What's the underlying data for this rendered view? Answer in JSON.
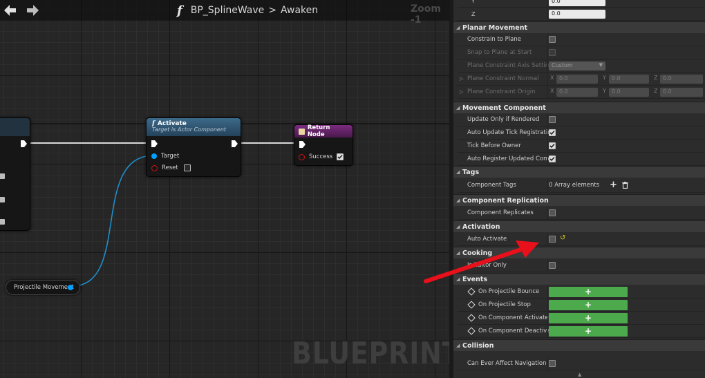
{
  "graph": {
    "breadcrumb": {
      "function_glyph": "f",
      "blueprint": "BP_SplineWave",
      "separator": ">",
      "event": "Awaken"
    },
    "zoom_label": "Zoom -1",
    "watermark": "BLUEPRINT",
    "nodes": {
      "activate": {
        "title": "Activate",
        "subtitle": "Target is Actor Component",
        "pin_target": "Target",
        "pin_reset": "Reset"
      },
      "return": {
        "title": "Return Node",
        "pin_success": "Success"
      },
      "variable": {
        "label": "Projectile Movement"
      }
    }
  },
  "panel": {
    "vector_rows": [
      {
        "axis": "Y",
        "value": "0.0"
      },
      {
        "axis": "Z",
        "value": "0.0"
      }
    ],
    "categories": {
      "planar": "Planar Movement",
      "movement_component": "Movement Component",
      "tags": "Tags",
      "replication": "Component Replication",
      "activation": "Activation",
      "cooking": "Cooking",
      "events": "Events",
      "collision": "Collision"
    },
    "planar": {
      "constrain_to_plane": "Constrain to Plane",
      "snap_to_plane": "Snap to Plane at Start",
      "axis_setting_label": "Plane Constraint Axis Setting",
      "axis_setting_value": "Custom",
      "normal_label": "Plane Constraint Normal",
      "origin_label": "Plane Constraint Origin",
      "normal": {
        "x": "0.0",
        "y": "0.0",
        "z": "0.0"
      },
      "origin": {
        "x": "0.0",
        "y": "0.0",
        "z": "0.0"
      },
      "axis_x": "X",
      "axis_y": "Y",
      "axis_z": "Z"
    },
    "movement_component": {
      "update_only_if_rendered": "Update Only if Rendered",
      "auto_update_tick": "Auto Update Tick Registration",
      "tick_before_owner": "Tick Before Owner",
      "auto_register": "Auto Register Updated Component"
    },
    "tags": {
      "label": "Component Tags",
      "value": "0 Array elements"
    },
    "replication": {
      "label": "Component Replicates"
    },
    "activation": {
      "label": "Auto Activate"
    },
    "cooking": {
      "label": "Is Editor Only"
    },
    "events": [
      "On Projectile Bounce",
      "On Projectile Stop",
      "On Component Activated",
      "On Component Deactivated"
    ],
    "collision": {
      "label": "Can Ever Affect Navigation"
    }
  },
  "colors": {
    "accent_green": "#4caa4c",
    "wire_blue": "#1e8fcc",
    "annotation_red": "#e8101a"
  }
}
